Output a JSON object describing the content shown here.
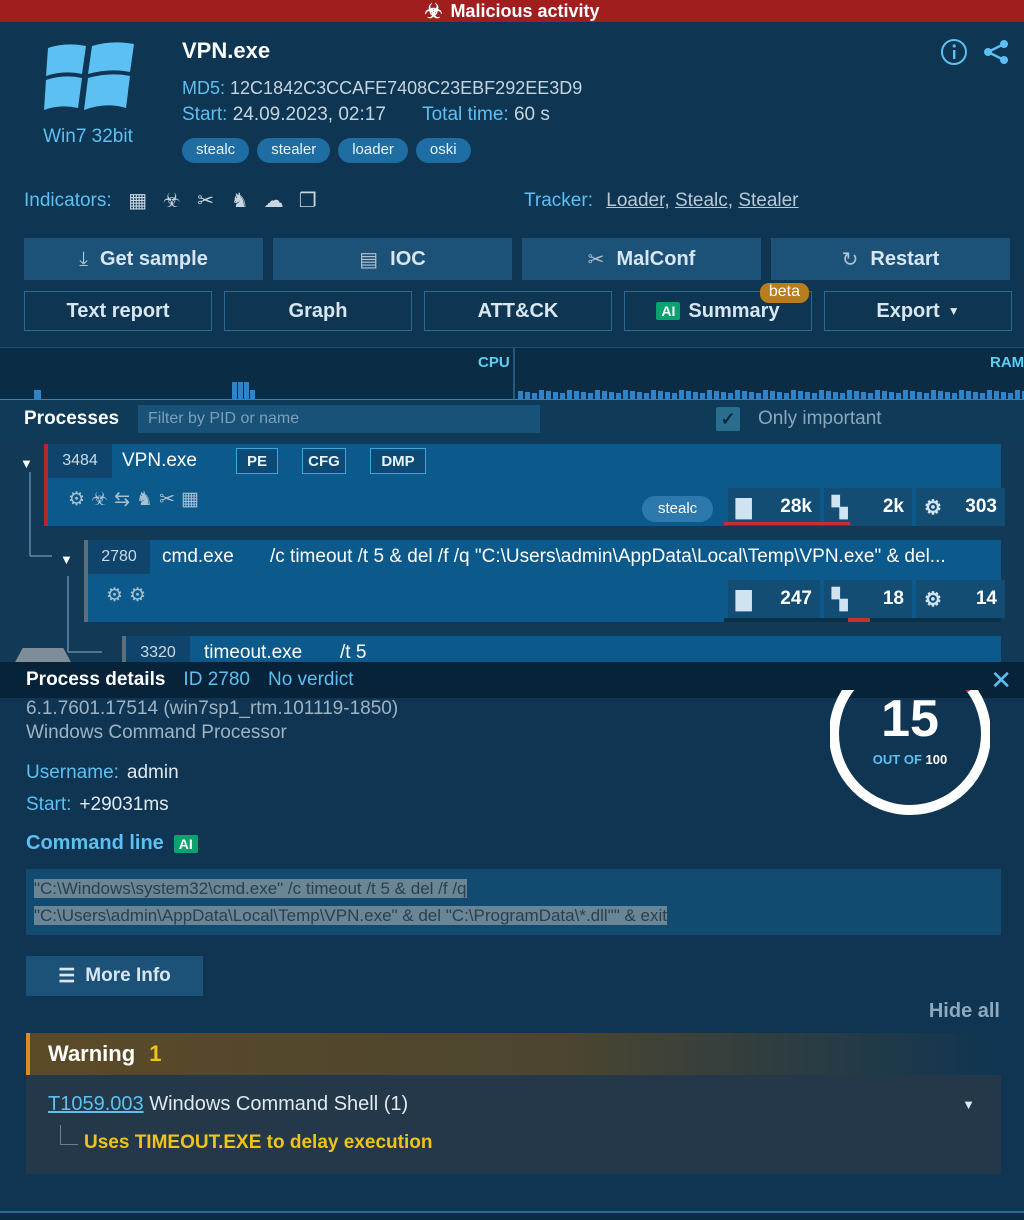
{
  "verdict_banner": {
    "icon": "biohazard-icon",
    "text": "Malicious activity"
  },
  "task": {
    "os_label": "Win7 32bit",
    "file_name": "VPN.exe",
    "md5_label": "MD5:",
    "md5_value": "12C1842C3CCAFE7408C23EBF292EE3D9",
    "start_label": "Start:",
    "start_value": "24.09.2023, 02:17",
    "total_label": "Total time:",
    "total_value": "60 s",
    "tags": [
      "stealc",
      "stealer",
      "loader",
      "oski"
    ]
  },
  "header_icons": [
    "info-icon",
    "share-icon"
  ],
  "indicators": {
    "label": "Indicators:",
    "icons": [
      "executable-icon",
      "biohazard-icon",
      "tools-icon",
      "spy-icon",
      "network-icon",
      "windows-icon"
    ]
  },
  "tracker": {
    "label": "Tracker:",
    "links": [
      "Loader,",
      "Stealc,",
      "Stealer"
    ]
  },
  "buttons_primary": [
    {
      "label": "Get sample",
      "icon": "download-icon",
      "glyph": "⤓"
    },
    {
      "label": "IOC",
      "icon": "list-icon",
      "glyph": "▤"
    },
    {
      "label": "MalConf",
      "icon": "tools-icon",
      "glyph": "✂"
    },
    {
      "label": "Restart",
      "icon": "restart-icon",
      "glyph": "↻"
    }
  ],
  "buttons_secondary": {
    "text_report": "Text report",
    "graph": "Graph",
    "attck": "ATT&CK",
    "ai_badge": "AI",
    "summary": "Summary",
    "beta": "beta",
    "export": "Export"
  },
  "charts": {
    "cpu_label": "CPU",
    "ram_label": "RAM",
    "colors": {
      "bars": "#2f83c6",
      "background": "#0a2c44"
    }
  },
  "processes_panel": {
    "title": "Processes",
    "filter_placeholder": "Filter by PID or name",
    "only_important_label": "Only important",
    "only_important_checked": true
  },
  "processes": [
    {
      "pid": "3484",
      "name": "VPN.exe",
      "badges": [
        "PE",
        "CFG",
        "DMP"
      ],
      "tag": "stealc",
      "files": "28k",
      "registry": "2k",
      "modules": "303",
      "activity_icons": [
        "executable-icon",
        "biohazard-icon",
        "exchange-icon",
        "spy-icon",
        "tools-icon",
        "document-icon"
      ]
    },
    {
      "pid": "2780",
      "name": "cmd.exe",
      "cmd": "/c timeout /t 5 & del /f /q \"C:\\Users\\admin\\AppData\\Local\\Temp\\VPN.exe\" & del...",
      "files": "247",
      "registry": "18",
      "modules": "14",
      "activity_icons": [
        "certificate-icon",
        "executable-icon"
      ]
    },
    {
      "pid": "3320",
      "name": "timeout.exe",
      "cmd": "/t 5"
    }
  ],
  "details": {
    "title": "Process details",
    "id_text": "ID 2780",
    "verdict": "No verdict",
    "version": "6.1.7601.17514 (win7sp1_rtm.101119-1850)",
    "description": "Windows Command Processor",
    "username_label": "Username:",
    "username": "admin",
    "start_label": "Start:",
    "start": "+29031ms",
    "cmd_label": "Command line",
    "ai_badge": "AI",
    "command_line_1": "\"C:\\Windows\\system32\\cmd.exe\" /c timeout /t 5 & del /f /q",
    "command_line_2": "\"C:\\Users\\admin\\AppData\\Local\\Temp\\VPN.exe\" & del \"C:\\ProgramData\\*.dll\"\" & exit",
    "more_info": "More Info",
    "hide_all": "Hide all",
    "score": "15",
    "score_caption_prefix": "OUT OF",
    "score_caption_max": "100",
    "score_value": 15,
    "score_max": 100
  },
  "warning": {
    "label": "Warning",
    "count": "1",
    "technique_id": "T1059.003",
    "technique_name": "Windows Command Shell (1)",
    "detail": "Uses TIMEOUT.EXE to delay execution"
  }
}
